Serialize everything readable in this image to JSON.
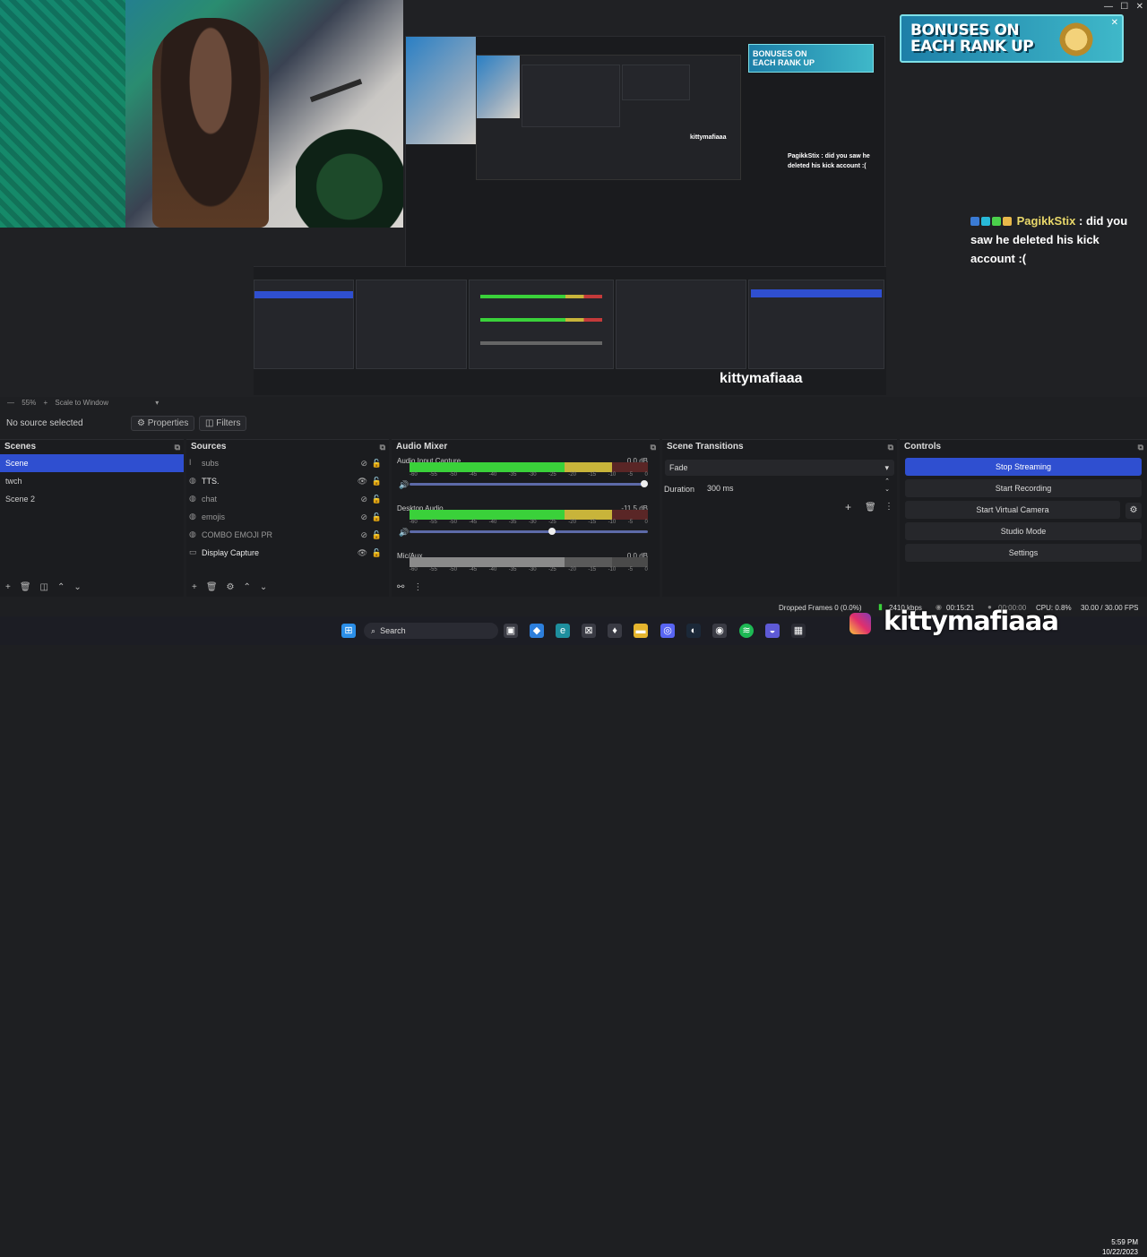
{
  "preview": {
    "banner_line1": "BONUSES ON",
    "banner_line2": "EACH RANK UP",
    "chat": {
      "user": "PagikkStix",
      "sep": " : ",
      "message": "did you saw he deleted his kick account :("
    },
    "nested_banner_line1": "BONUSES ON",
    "nested_banner_line2": "EACH RANK UP",
    "nested_chat": "PagikkStix : did you saw he deleted his kick account :(",
    "nested_watermark": "kittymafiaaa"
  },
  "scale": {
    "zoom": "55%",
    "mode": "Scale to Window"
  },
  "source_bar": {
    "status": "No source selected",
    "properties": "Properties",
    "filters": "Filters"
  },
  "scenes": {
    "title": "Scenes",
    "items": [
      "Scene",
      "twch",
      "Scene 2"
    ],
    "selected": 0
  },
  "sources": {
    "title": "Sources",
    "items": [
      {
        "name": "subs",
        "icon": "text-icon",
        "visible": false
      },
      {
        "name": "TTS.",
        "icon": "browser-icon",
        "visible": true
      },
      {
        "name": "chat",
        "icon": "browser-icon",
        "visible": false
      },
      {
        "name": "emojis",
        "icon": "browser-icon",
        "visible": false
      },
      {
        "name": "COMBO EMOJI PR",
        "icon": "browser-icon",
        "visible": false
      },
      {
        "name": "Display Capture",
        "icon": "monitor-icon",
        "visible": true
      }
    ]
  },
  "mixer": {
    "title": "Audio Mixer",
    "channels": [
      {
        "name": "Audio Input Capture",
        "db": "0.0 dB",
        "level": 0.78,
        "volume": 1.0
      },
      {
        "name": "Desktop Audio",
        "db": "-11.5 dB",
        "level": 0.68,
        "volume": 0.6
      },
      {
        "name": "Mic/Aux",
        "db": "0.0 dB",
        "level": 0.0,
        "volume": 1.0
      }
    ],
    "ticks": [
      "-60",
      "-55",
      "-50",
      "-45",
      "-40",
      "-35",
      "-30",
      "-25",
      "-20",
      "-15",
      "-10",
      "-5",
      "0"
    ]
  },
  "transitions": {
    "title": "Scene Transitions",
    "selected": "Fade",
    "duration_label": "Duration",
    "duration_value": "300 ms"
  },
  "controls": {
    "title": "Controls",
    "buttons": [
      "Stop Streaming",
      "Start Recording",
      "Start Virtual Camera",
      "Studio Mode",
      "Settings"
    ]
  },
  "status": {
    "dropped": "Dropped Frames 0 (0.0%)",
    "kbps": "2410 kbps",
    "live_time": "00:15:21",
    "rec_time": "00:00:00",
    "cpu": "CPU: 0.8%",
    "fps": "30.00 / 30.00 FPS"
  },
  "taskbar": {
    "search": "Search",
    "time": "5:59 PM",
    "date": "10/22/2023"
  },
  "watermark": "kittymafiaaa",
  "colors": {
    "accent": "#2f4fd0",
    "meter_green": "#3ad13a",
    "meter_yellow": "#c8b43a",
    "meter_red": "#c43a3a"
  }
}
